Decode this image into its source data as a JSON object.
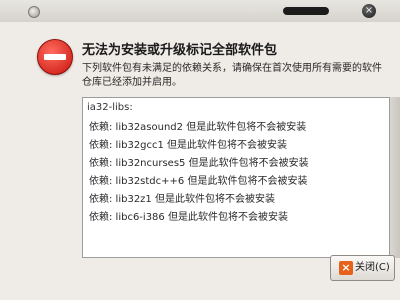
{
  "window": {
    "menu_icon": "window-menu-icon",
    "close_icon": "window-close-icon",
    "close_glyph": "×"
  },
  "dialog": {
    "icon": "error-icon",
    "headline": "无法为安装或升级标记全部软件包",
    "message": "下列软件包有未满足的依赖关系，请确保在首次使用所有需要的软件仓库已经添加并启用。",
    "list_header": "ia32-libs:",
    "list_items": [
      "依赖: lib32asound2 但是此软件包将不会被安装",
      "依赖: lib32gcc1 但是此软件包将不会被安装",
      "依赖: lib32ncurses5 但是此软件包将不会被安装",
      "依赖: lib32stdc++6 但是此软件包将不会被安装",
      "依赖: lib32z1 但是此软件包将不会被安装",
      "依赖: libc6-i386 但是此软件包将不会被安装"
    ],
    "close_button": {
      "label": "关闭(C)",
      "icon": "close-x-icon",
      "glyph": "×"
    }
  },
  "colors": {
    "dialog_bg": "#efebe7",
    "error_red": "#c8140c",
    "close_icon_orange": "#e8611a"
  }
}
